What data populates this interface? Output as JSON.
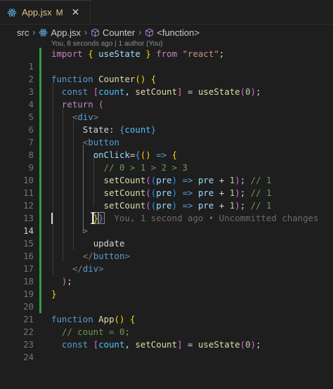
{
  "tab": {
    "label": "App.jsx",
    "status": "M",
    "icon": "react-icon",
    "close": "✕"
  },
  "breadcrumb": {
    "items": [
      {
        "label": "src",
        "icon": ""
      },
      {
        "label": "App.jsx",
        "icon": "react-icon"
      },
      {
        "label": "Counter",
        "icon": "symbol-icon"
      },
      {
        "label": "<function>",
        "icon": "symbol-icon"
      }
    ]
  },
  "codelens": "You, 8 seconds ago | 1 author (You)",
  "blame": "You, 1 second ago • Uncommitted changes",
  "code": {
    "lines": [
      {
        "n": "1"
      },
      {
        "n": "2"
      },
      {
        "n": "3"
      },
      {
        "n": "4"
      },
      {
        "n": "5"
      },
      {
        "n": "6"
      },
      {
        "n": "7"
      },
      {
        "n": "8"
      },
      {
        "n": "9"
      },
      {
        "n": "10"
      },
      {
        "n": "11"
      },
      {
        "n": "12"
      },
      {
        "n": "13"
      },
      {
        "n": "14"
      },
      {
        "n": "15"
      },
      {
        "n": "16"
      },
      {
        "n": "17"
      },
      {
        "n": "18"
      },
      {
        "n": "19"
      },
      {
        "n": "20"
      },
      {
        "n": "21"
      },
      {
        "n": "22"
      },
      {
        "n": "23"
      },
      {
        "n": "24"
      }
    ],
    "t": {
      "import": "import",
      "from": "from",
      "react": "\"react\"",
      "useState": "useState",
      "function": "function",
      "Counter": "Counter",
      "const": "const",
      "count": "count",
      "setCount": "setCount",
      "zero": "0",
      "return": "return",
      "div": "div",
      "State": "State: ",
      "button": "button",
      "onClick": "onClick",
      "cmt": "// 0 > 1 > 2 > 3",
      "pre": "pre",
      "one": "1",
      "c1": "// 1",
      "update": "update",
      "App": "App",
      "cmt2": "// count = 0;"
    }
  }
}
